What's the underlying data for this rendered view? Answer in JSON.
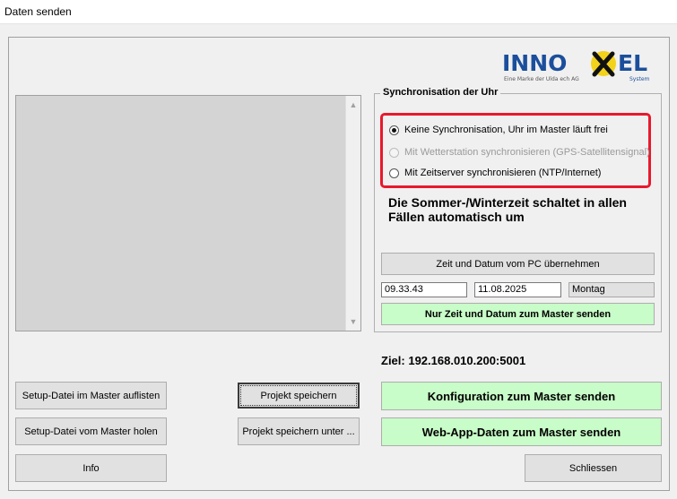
{
  "window": {
    "title": "Daten senden"
  },
  "logo": {
    "brand_left": "INNO",
    "brand_right": "EL",
    "tagline": "Eine Marke der Ulda ech AG",
    "system": "System"
  },
  "sync": {
    "group_title": "Synchronisation der Uhr",
    "options": [
      {
        "label": "Keine Synchronisation, Uhr im Master läuft frei",
        "selected": true,
        "enabled": true
      },
      {
        "label": "Mit Wetterstation synchronisieren (GPS-Satellitensignal)",
        "selected": false,
        "enabled": false
      },
      {
        "label": "Mit Zeitserver synchronisieren (NTP/Internet)",
        "selected": false,
        "enabled": true
      }
    ],
    "dst_note": "Die Sommer-/Winterzeit schaltet in allen Fällen automatisch um",
    "take_pc_button": "Zeit und Datum vom PC übernehmen",
    "time_value": "09.33.43",
    "date_value": "11.08.2025",
    "weekday": "Montag",
    "send_time_button": "Nur Zeit und Datum zum Master senden"
  },
  "target": "Ziel: 192.168.010.200:5001",
  "buttons": {
    "setup_list": "Setup-Datei im Master auflisten",
    "setup_get": "Setup-Datei vom Master holen",
    "info": "Info",
    "project_save": "Projekt speichern",
    "project_save_as": "Projekt speichern unter ...",
    "send_config": "Konfiguration zum Master senden",
    "send_webapp": "Web-App-Daten zum Master senden",
    "close": "Schliessen"
  },
  "colors": {
    "highlight_red": "#e8192c",
    "send_green": "#c8fcc8",
    "logo_blue": "#1b4f9c",
    "logo_yellow": "#f3d21b"
  }
}
